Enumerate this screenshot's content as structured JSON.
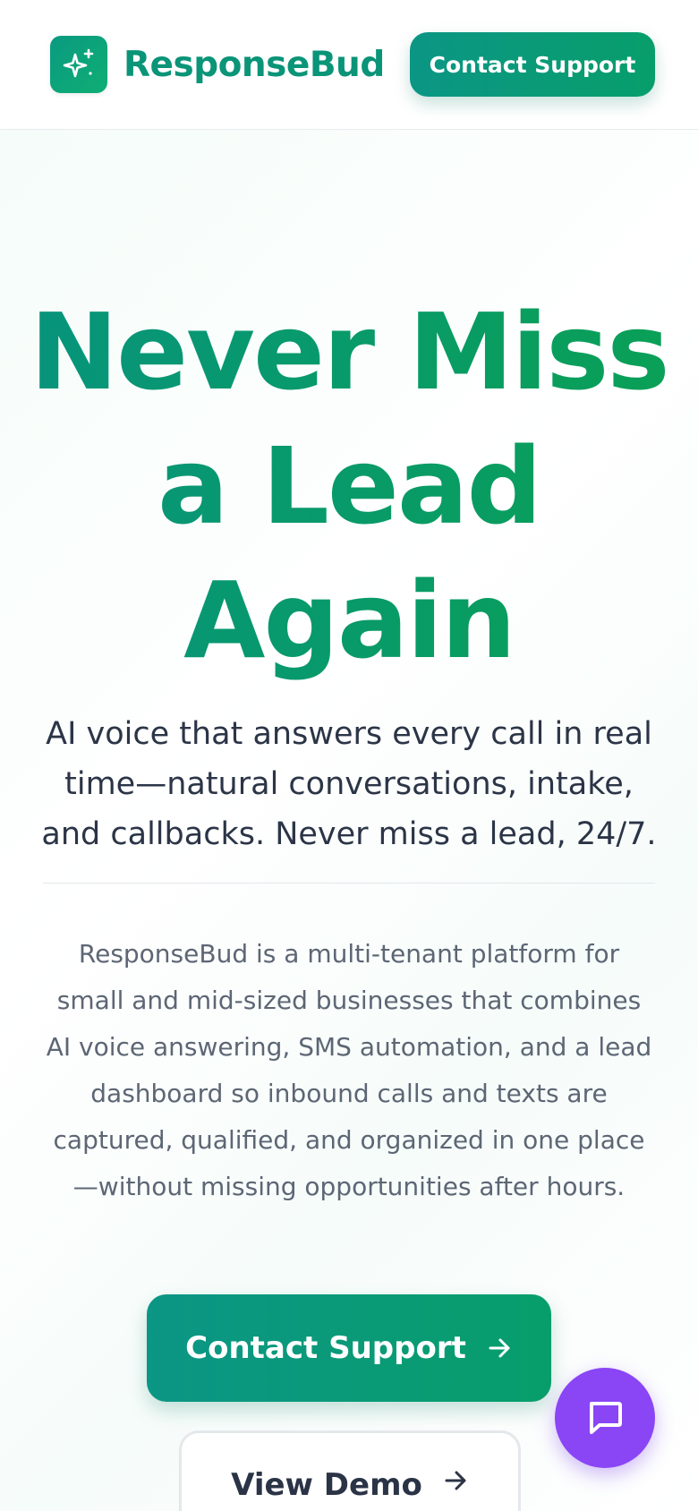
{
  "header": {
    "brand_name": "ResponseBud",
    "brand_icon": "sparkles-icon",
    "cta_label": "Contact Support"
  },
  "hero": {
    "title_line1": "Never Miss",
    "title_line2": "a Lead",
    "title_line3": "Again",
    "subtitle_line1": "AI voice that answers every call in real",
    "subtitle_line2": "time—natural conversations, intake,",
    "subtitle_line3": "and callbacks. Never miss a lead, 24/7.",
    "description_line1": "ResponseBud is a multi-tenant platform for",
    "description_line2": "small and mid-sized businesses that combines",
    "description_line3": "AI voice answering, SMS automation, and a lead",
    "description_line4": "dashboard so inbound calls and texts are",
    "description_line5": "captured, qualified, and organized in one place",
    "description_line6": "—without missing opportunities after hours."
  },
  "cta": {
    "primary_label": "Contact Support",
    "secondary_label": "View Demo",
    "arrow_icon": "arrow-right-icon"
  },
  "chat": {
    "icon": "chat-bubble-icon"
  },
  "colors": {
    "brand": "#0a9478",
    "brand_gradient_start": "#0b9685",
    "brand_gradient_end": "#089e6b",
    "chat_fab": "#8a45f5",
    "text_dark": "#2c3547",
    "text_muted": "#5d6674"
  }
}
